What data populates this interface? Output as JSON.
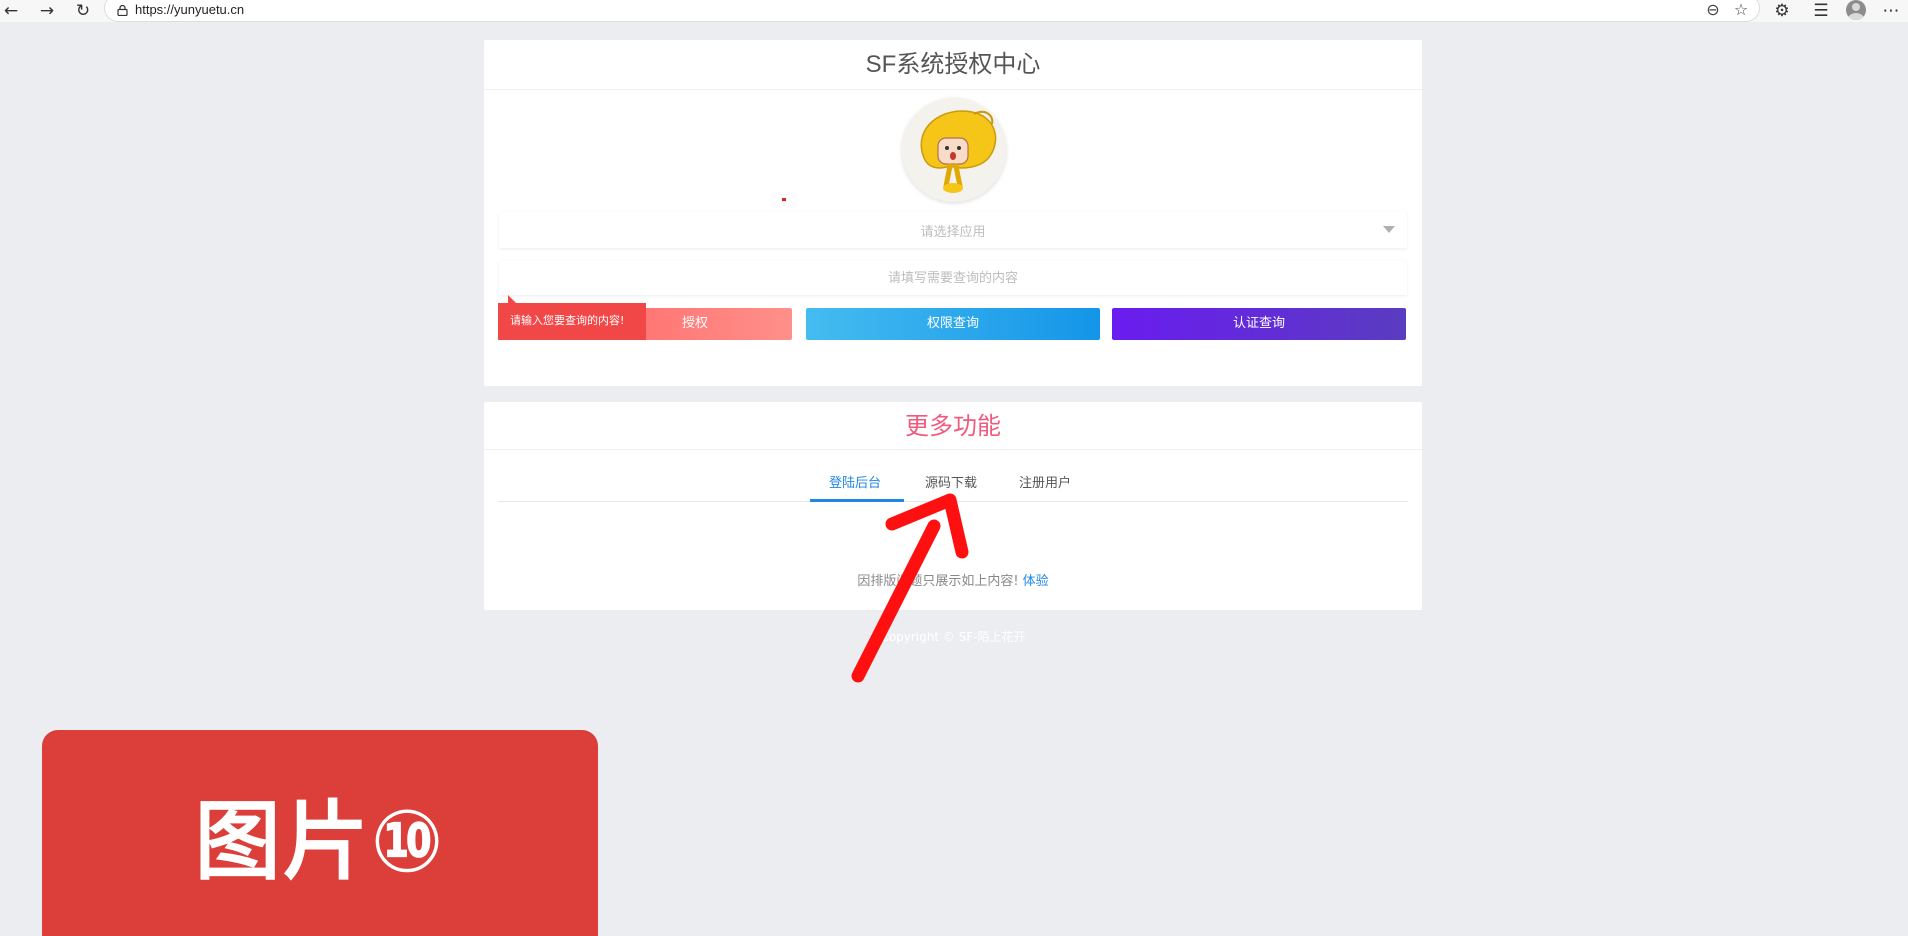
{
  "browser": {
    "url": "https://yunyuetu.cn"
  },
  "card_auth": {
    "title": "SF系统授权中心",
    "select_placeholder": "请选择应用",
    "input_placeholder": "请填写需要查询的内容",
    "tooltip": "请输入您要查询的内容!",
    "buttons": {
      "auth": "授权",
      "perm": "权限查询",
      "cert": "认证查询"
    }
  },
  "card_more": {
    "title": "更多功能",
    "tabs": [
      "登陆后台",
      "源码下载",
      "注册用户"
    ],
    "notice_text": "因排版问题只展示如上内容!",
    "notice_link": "体验"
  },
  "footer": {
    "copyright": "Copyright © SF-陌上花开"
  },
  "annotation": {
    "label": "图片⑩"
  },
  "colors": {
    "page_bg": "#ebedf1",
    "accent_blue": "#1e88e5",
    "title_pink": "#f05a7e",
    "tooltip_red": "#f24747",
    "label_red": "#dc3e3a"
  }
}
